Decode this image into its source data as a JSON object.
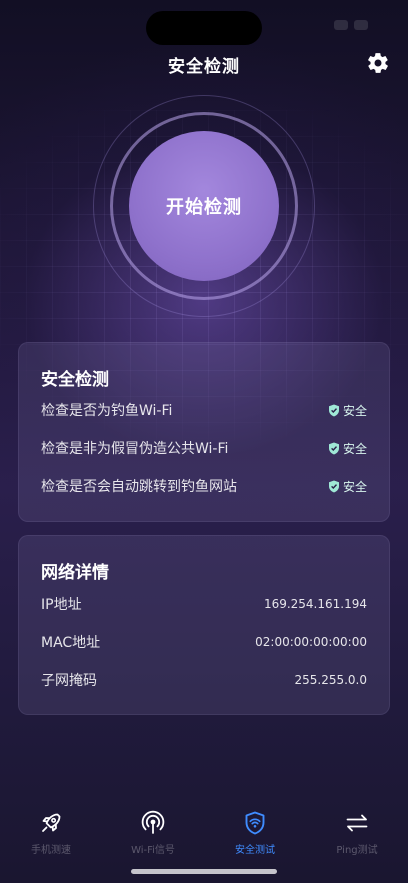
{
  "status_bar": {
    "time": ""
  },
  "header": {
    "title": "安全检测"
  },
  "scan": {
    "button_label": "开始检测"
  },
  "security_card": {
    "title": "安全检测",
    "items": [
      {
        "label": "检查是否为钓鱼Wi-Fi",
        "status": "安全"
      },
      {
        "label": "检查是非为假冒伪造公共Wi-Fi",
        "status": "安全"
      },
      {
        "label": "检查是否会自动跳转到钓鱼网站",
        "status": "安全"
      }
    ]
  },
  "network_card": {
    "title": "网络详情",
    "items": [
      {
        "label": "IP地址",
        "value": "169.254.161.194"
      },
      {
        "label": "MAC地址",
        "value": "02:00:00:00:00:00"
      },
      {
        "label": "子网掩码",
        "value": "255.255.0.0"
      }
    ]
  },
  "tabs": [
    {
      "label": "手机测速",
      "icon": "rocket-icon",
      "active": false
    },
    {
      "label": "Wi-Fi信号",
      "icon": "signal-icon",
      "active": false
    },
    {
      "label": "安全测试",
      "icon": "shield-wifi-icon",
      "active": true
    },
    {
      "label": "Ping测试",
      "icon": "arrows-icon",
      "active": false
    }
  ],
  "colors": {
    "accent": "#3f8cff",
    "scan_button": "#8f72cc",
    "safe_badge": "#9fe8d6"
  }
}
